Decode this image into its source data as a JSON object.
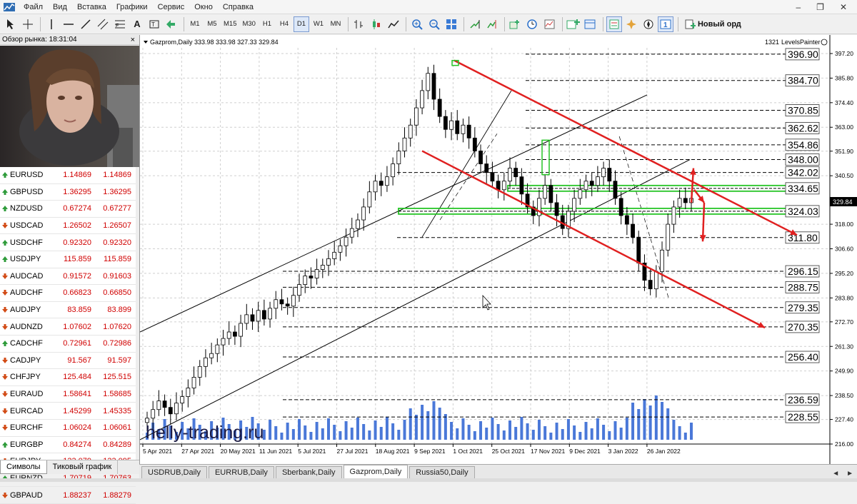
{
  "menu": {
    "items": [
      "Файл",
      "Вид",
      "Вставка",
      "Графики",
      "Сервис",
      "Окно",
      "Справка"
    ]
  },
  "toolbar": {
    "timeframes": [
      "M1",
      "M5",
      "M15",
      "M30",
      "H1",
      "H4",
      "D1",
      "W1",
      "MN"
    ],
    "active_timeframe": "D1",
    "new_order_label": "Новый орд"
  },
  "market_watch": {
    "title": "Обзор рынка: 18:31:04",
    "symbols": [
      {
        "name": "EURUSD",
        "bid": "1.14869",
        "ask": "1.14869",
        "dir": "up"
      },
      {
        "name": "GBPUSD",
        "bid": "1.36295",
        "ask": "1.36295",
        "dir": "up"
      },
      {
        "name": "NZDUSD",
        "bid": "0.67274",
        "ask": "0.67277",
        "dir": "up"
      },
      {
        "name": "USDCAD",
        "bid": "1.26502",
        "ask": "1.26507",
        "dir": "down"
      },
      {
        "name": "USDCHF",
        "bid": "0.92320",
        "ask": "0.92320",
        "dir": "up"
      },
      {
        "name": "USDJPY",
        "bid": "115.859",
        "ask": "115.859",
        "dir": "up"
      },
      {
        "name": "AUDCAD",
        "bid": "0.91572",
        "ask": "0.91603",
        "dir": "down"
      },
      {
        "name": "AUDCHF",
        "bid": "0.66823",
        "ask": "0.66850",
        "dir": "down"
      },
      {
        "name": "AUDJPY",
        "bid": "83.859",
        "ask": "83.899",
        "dir": "down"
      },
      {
        "name": "AUDNZD",
        "bid": "1.07602",
        "ask": "1.07620",
        "dir": "down"
      },
      {
        "name": "CADCHF",
        "bid": "0.72961",
        "ask": "0.72986",
        "dir": "up"
      },
      {
        "name": "CADJPY",
        "bid": "91.567",
        "ask": "91.597",
        "dir": "down"
      },
      {
        "name": "CHFJPY",
        "bid": "125.484",
        "ask": "125.515",
        "dir": "down"
      },
      {
        "name": "EURAUD",
        "bid": "1.58641",
        "ask": "1.58685",
        "dir": "down"
      },
      {
        "name": "EURCAD",
        "bid": "1.45299",
        "ask": "1.45335",
        "dir": "down"
      },
      {
        "name": "EURCHF",
        "bid": "1.06024",
        "ask": "1.06061",
        "dir": "down"
      },
      {
        "name": "EURGBP",
        "bid": "0.84274",
        "ask": "0.84289",
        "dir": "up"
      },
      {
        "name": "EURJPY",
        "bid": "133.079",
        "ask": "133.095",
        "dir": "down"
      },
      {
        "name": "EURNZD",
        "bid": "1.70719",
        "ask": "1.70763",
        "dir": "up"
      },
      {
        "name": "GBPAUD",
        "bid": "1.88237",
        "ask": "1.88279",
        "dir": "down"
      }
    ],
    "tabs": [
      "Символы",
      "Тиковый график"
    ],
    "active_tab": "Символы"
  },
  "chart": {
    "header": "Gazprom,Daily  333.98 333.98 327.33 329.84",
    "indicator_label": "LevelsPainter",
    "bars_count": "1321",
    "current_price": "329.84",
    "watermark": "helly-trading.ru"
  },
  "chart_tabs": {
    "items": [
      "USDRUB,Daily",
      "EURRUB,Daily",
      "Sberbank,Daily",
      "Gazprom,Daily",
      "Russia50,Daily"
    ],
    "active": "Gazprom,Daily"
  },
  "chart_data": {
    "type": "candlestick",
    "title": "Gazprom,Daily",
    "y_ticks": [
      "397.20",
      "385.80",
      "374.40",
      "363.00",
      "351.90",
      "340.50",
      "318.00",
      "306.60",
      "295.20",
      "283.80",
      "272.70",
      "261.30",
      "249.90",
      "238.50",
      "227.40",
      "216.00"
    ],
    "ylim": [
      216.0,
      397.2
    ],
    "x_ticks": [
      "5 Apr 2021",
      "27 Apr 2021",
      "20 May 2021",
      "11 Jun 2021",
      "5 Jul 2021",
      "27 Jul 2021",
      "18 Aug 2021",
      "9 Sep 2021",
      "1 Oct 2021",
      "25 Oct 2021",
      "17 Nov 2021",
      "9 Dec 2021",
      "3 Jan 2022",
      "26 Jan 2022"
    ],
    "levels": [
      {
        "label": "396.90",
        "value": 396.9,
        "style": "dashed"
      },
      {
        "label": "384.70",
        "value": 384.7,
        "style": "dashed"
      },
      {
        "label": "370.85",
        "value": 370.85,
        "style": "dashed"
      },
      {
        "label": "362.62",
        "value": 362.62,
        "style": "dashed"
      },
      {
        "label": "354.86",
        "value": 354.86,
        "style": "dashed"
      },
      {
        "label": "348.00",
        "value": 348.0,
        "style": "dashed"
      },
      {
        "label": "342.02",
        "value": 342.02,
        "style": "dashed"
      },
      {
        "label": "334.65",
        "value": 334.65,
        "style": "zone"
      },
      {
        "label": "324.03",
        "value": 324.03,
        "style": "zone"
      },
      {
        "label": "311.80",
        "value": 311.8,
        "style": "dashed"
      },
      {
        "label": "296.15",
        "value": 296.15,
        "style": "dashed"
      },
      {
        "label": "288.75",
        "value": 288.75,
        "style": "dashed"
      },
      {
        "label": "279.35",
        "value": 279.35,
        "style": "dashed"
      },
      {
        "label": "270.35",
        "value": 270.35,
        "style": "dashed"
      },
      {
        "label": "256.40",
        "value": 256.4,
        "style": "dashed"
      },
      {
        "label": "236.59",
        "value": 236.59,
        "style": "dashed"
      },
      {
        "label": "228.55",
        "value": 228.55,
        "style": "dashed"
      }
    ],
    "closes": [
      228,
      232,
      236,
      233,
      230,
      235,
      238,
      242,
      247,
      252,
      256,
      258,
      262,
      265,
      268,
      266,
      272,
      276,
      273,
      278,
      274,
      279,
      283,
      281,
      280,
      285,
      290,
      294,
      293,
      297,
      299,
      302,
      305,
      308,
      312,
      316,
      320,
      326,
      333,
      338,
      336,
      340,
      346,
      352,
      358,
      364,
      372,
      380,
      388,
      376,
      368,
      362,
      366,
      360,
      364,
      358,
      352,
      346,
      342,
      338,
      334,
      338,
      344,
      340,
      332,
      326,
      322,
      330,
      336,
      328,
      322,
      316,
      324,
      330,
      334,
      338,
      336,
      340,
      344,
      338,
      330,
      322,
      318,
      312,
      300,
      292,
      288,
      296,
      306,
      318,
      326,
      330,
      328,
      330
    ]
  }
}
